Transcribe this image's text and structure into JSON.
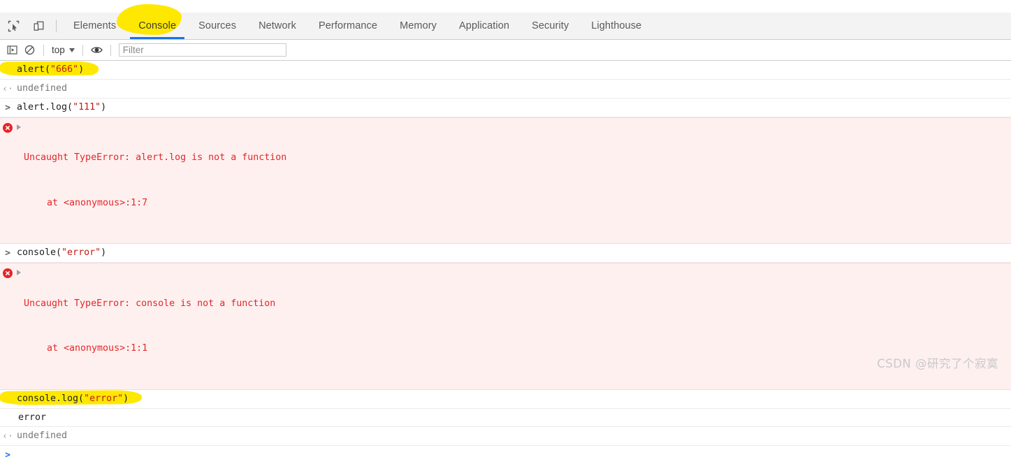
{
  "window": {
    "app": "Chrome DevTools"
  },
  "tabbar": {
    "icons": [
      {
        "name": "inspect-element-icon"
      },
      {
        "name": "device-toolbar-icon"
      }
    ],
    "tabs": [
      {
        "label": "Elements",
        "active": false
      },
      {
        "label": "Console",
        "active": true
      },
      {
        "label": "Sources",
        "active": false
      },
      {
        "label": "Network",
        "active": false
      },
      {
        "label": "Performance",
        "active": false
      },
      {
        "label": "Memory",
        "active": false
      },
      {
        "label": "Application",
        "active": false
      },
      {
        "label": "Security",
        "active": false
      },
      {
        "label": "Lighthouse",
        "active": false
      }
    ],
    "active_tab": "Console",
    "active_indicator_color": "#1a73e8",
    "highlight_color": "#ffe800"
  },
  "toolbar": {
    "sidebar_toggle_icon": "console-sidebar-icon",
    "clear_console_icon": "clear-console-icon",
    "context": "top",
    "eye_icon": "live-expression-eye-icon",
    "filter": {
      "value": "",
      "placeholder": "Filter"
    }
  },
  "console": {
    "entries": [
      {
        "kind": "input",
        "gutter": ">",
        "code": "alert(",
        "string": "\"666\"",
        "code_tail": ")",
        "highlighted": true
      },
      {
        "kind": "result",
        "gutter": "<",
        "text": "undefined"
      },
      {
        "kind": "input",
        "gutter": ">",
        "code": "alert.log(",
        "string": "\"111\"",
        "code_tail": ")",
        "highlighted": false
      },
      {
        "kind": "error",
        "message": "Uncaught TypeError: alert.log is not a function",
        "stack": "at <anonymous>:1:7"
      },
      {
        "kind": "input",
        "gutter": ">",
        "code": "console(",
        "string": "\"error\"",
        "code_tail": ")",
        "highlighted": false
      },
      {
        "kind": "error",
        "message": "Uncaught TypeError: console is not a function",
        "stack": "at <anonymous>:1:1"
      },
      {
        "kind": "input",
        "gutter": ">",
        "code": "console.log(",
        "string": "\"error\"",
        "code_tail": ")",
        "highlighted": true
      },
      {
        "kind": "log",
        "text": "error"
      },
      {
        "kind": "result",
        "gutter": "<",
        "text": "undefined"
      }
    ],
    "prompt": ">",
    "prompt_value": "",
    "colors": {
      "string": "#c41a16",
      "error_text": "#e32727",
      "error_bg": "#fff0f0",
      "result_text": "#767676",
      "prompt_arrow": "#1a73e8"
    }
  },
  "watermark": {
    "text": "CSDN @研究了个寂寞"
  }
}
